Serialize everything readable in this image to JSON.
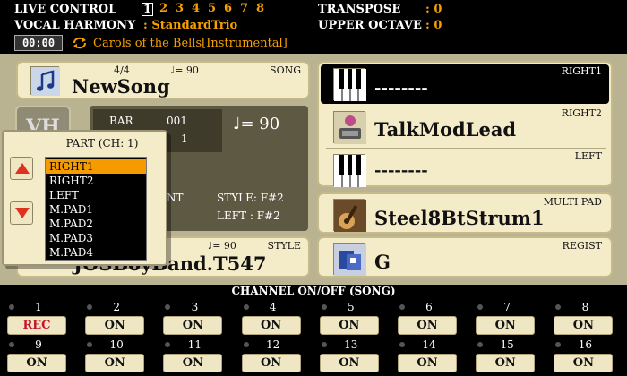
{
  "header": {
    "live_control_label": "LIVE CONTROL",
    "live_control_numbers": [
      "1",
      "2",
      "3",
      "4",
      "5",
      "6",
      "7",
      "8"
    ],
    "live_control_active": "1",
    "vocal_harmony_label": "VOCAL HARMONY",
    "vocal_harmony_value": ": StandardTrio",
    "transpose_label": "TRANSPOSE",
    "transpose_value": ": 0",
    "upper_octave_label": "UPPER OCTAVE",
    "upper_octave_value": ": 0",
    "time": "00:00",
    "song_title": "Carols of the Bells[Instrumental]",
    "loop_icon": "loop-arrows-icon"
  },
  "song": {
    "time_signature": "4/4",
    "tempo": "♩= 90",
    "tag": "SONG",
    "name": "NewSong",
    "icon": "music-note-icon"
  },
  "info": {
    "bar_label": "BAR",
    "bar_value": "001",
    "beat_value": "1",
    "tempo": "♩=  90",
    "part_fragment": "NT",
    "style_chord": "STYLE:  F#2",
    "left_chord": "LEFT  :  F#2",
    "vh_label": "VH"
  },
  "style": {
    "tempo": "♩= 90",
    "tag": "STYLE",
    "name": "JOSBoyBand.T547"
  },
  "voices": {
    "right1_tag": "RIGHT1",
    "right1_name": "--------",
    "right2_tag": "RIGHT2",
    "right2_name": "TalkModLead",
    "left_tag": "LEFT",
    "left_name": "--------"
  },
  "multi_pad": {
    "tag": "MULTI PAD",
    "name": "Steel8BtStrum1"
  },
  "regist": {
    "tag": "REGIST",
    "name": "G"
  },
  "popup": {
    "title": "PART (CH:  1)",
    "items": [
      "RIGHT1",
      "RIGHT2",
      "LEFT",
      "M.PAD1",
      "M.PAD2",
      "M.PAD3",
      "M.PAD4"
    ],
    "selected": "RIGHT1"
  },
  "channels": {
    "title": "CHANNEL ON/OFF (SONG)",
    "list": [
      {
        "num": "1",
        "state": "REC"
      },
      {
        "num": "2",
        "state": "ON"
      },
      {
        "num": "3",
        "state": "ON"
      },
      {
        "num": "4",
        "state": "ON"
      },
      {
        "num": "5",
        "state": "ON"
      },
      {
        "num": "6",
        "state": "ON"
      },
      {
        "num": "7",
        "state": "ON"
      },
      {
        "num": "8",
        "state": "ON"
      },
      {
        "num": "9",
        "state": "ON"
      },
      {
        "num": "10",
        "state": "ON"
      },
      {
        "num": "11",
        "state": "ON"
      },
      {
        "num": "12",
        "state": "ON"
      },
      {
        "num": "13",
        "state": "ON"
      },
      {
        "num": "14",
        "state": "ON"
      },
      {
        "num": "15",
        "state": "ON"
      },
      {
        "num": "16",
        "state": "ON"
      }
    ]
  },
  "colors": {
    "accent_orange": "#f5a000",
    "panel_cream": "#f4ecc8",
    "rec_red": "#c8102e"
  }
}
